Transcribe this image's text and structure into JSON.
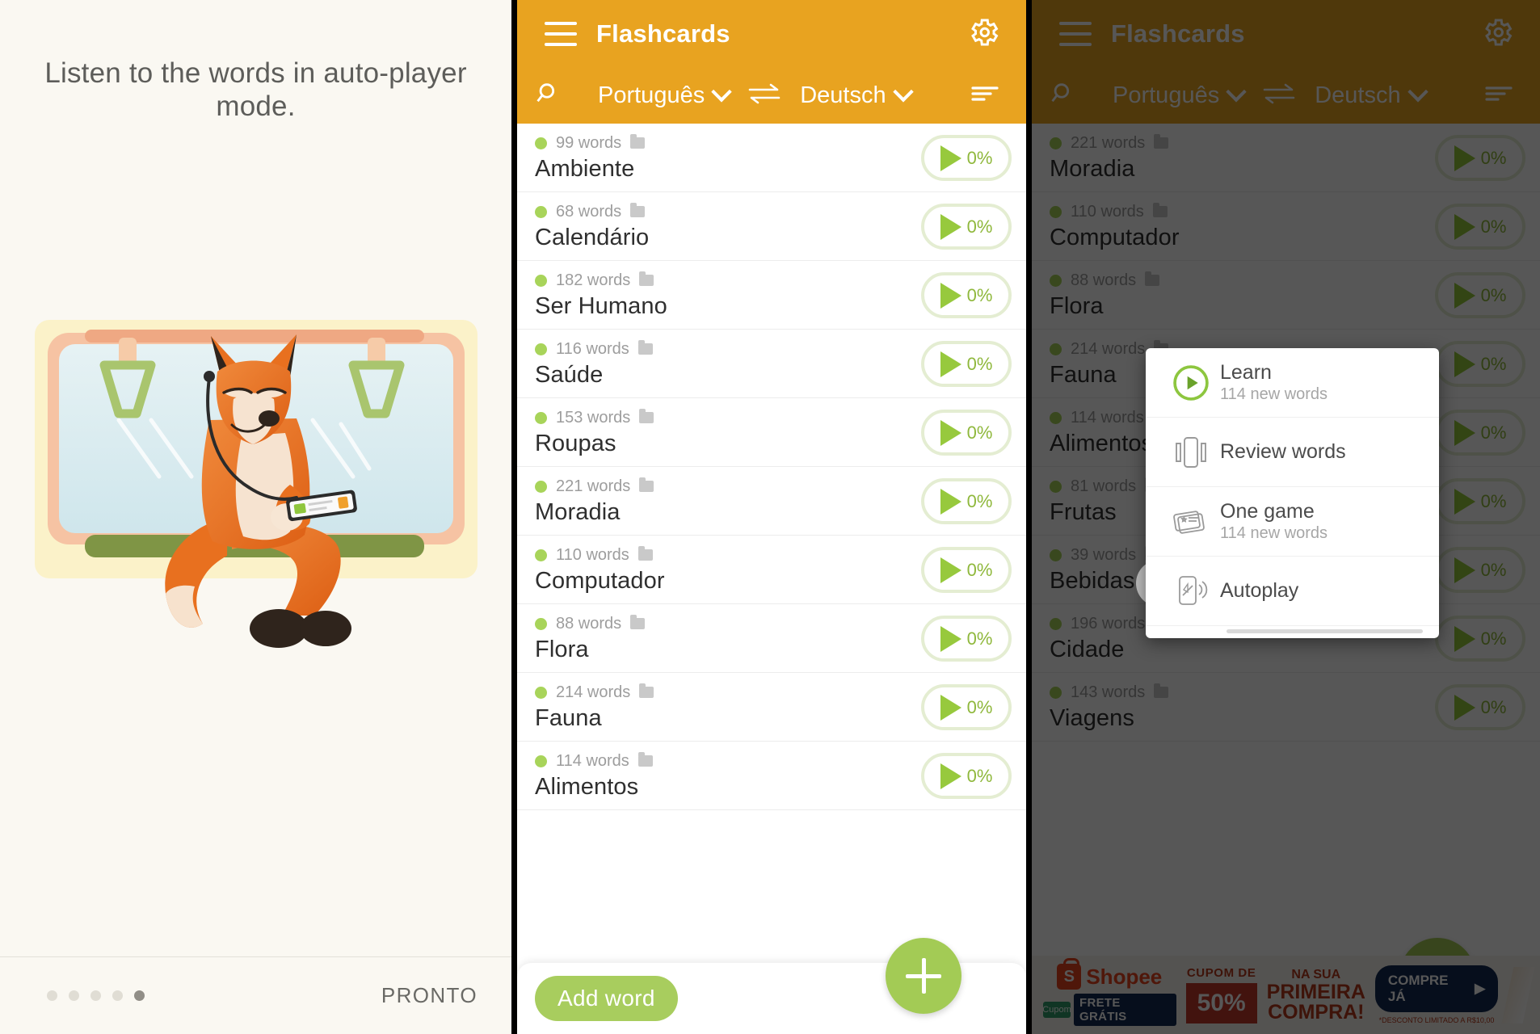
{
  "onboarding": {
    "message": "Listen to the words in auto-player mode.",
    "illustration_alt": "fox-listening-music-on-train",
    "dots_total": 5,
    "dots_active_index": 4,
    "done_label": "PRONTO"
  },
  "appbar": {
    "title": "Flashcards",
    "menu_icon": "hamburger-icon",
    "settings_icon": "gear-icon",
    "search_icon": "search-icon",
    "sort_icon": "sort-icon",
    "swap_icon": "swap-languages-icon",
    "source_language": "Português",
    "target_language": "Deutsch",
    "accent_color": "#e8a320"
  },
  "colors": {
    "accent": "#e8a320",
    "green": "#a3cb55",
    "play_green": "#97c93d",
    "pill_border": "#e4edd2",
    "text_dark": "#2f2f2f",
    "text_muted": "#9d9d9d"
  },
  "list_middle": {
    "items": [
      {
        "words": "99 words",
        "title": "Ambiente",
        "progress": "0%"
      },
      {
        "words": "68 words",
        "title": "Calendário",
        "progress": "0%"
      },
      {
        "words": "182 words",
        "title": "Ser Humano",
        "progress": "0%"
      },
      {
        "words": "116 words",
        "title": "Saúde",
        "progress": "0%"
      },
      {
        "words": "153 words",
        "title": "Roupas",
        "progress": "0%"
      },
      {
        "words": "221 words",
        "title": "Moradia",
        "progress": "0%"
      },
      {
        "words": "110 words",
        "title": "Computador",
        "progress": "0%"
      },
      {
        "words": "88 words",
        "title": "Flora",
        "progress": "0%"
      },
      {
        "words": "214 words",
        "title": "Fauna",
        "progress": "0%"
      },
      {
        "words": "114 words",
        "title": "Alimentos",
        "progress": "0%"
      }
    ]
  },
  "list_right": {
    "items": [
      {
        "words": "221 words",
        "title": "Moradia",
        "progress": "0%"
      },
      {
        "words": "110 words",
        "title": "Computador",
        "progress": "0%"
      },
      {
        "words": "88 words",
        "title": "Flora",
        "progress": "0%"
      },
      {
        "words": "214 words",
        "title": "Fauna",
        "progress": "0%"
      },
      {
        "words": "114 words",
        "title": "Alimentos",
        "progress": "0%"
      },
      {
        "words": "81 words",
        "title": "Frutas",
        "progress": "0%"
      },
      {
        "words": "39 words",
        "title": "Bebidas",
        "progress": "0%"
      },
      {
        "words": "196 words",
        "title": "Cidade",
        "progress": "0%"
      },
      {
        "words": "143 words",
        "title": "Viagens",
        "progress": "0%"
      }
    ]
  },
  "bottom": {
    "add_word_label": "Add word",
    "fab_icon": "plus-icon"
  },
  "popup": {
    "items": [
      {
        "label": "Learn",
        "sub": "114 new words",
        "icon": "play-circle-icon"
      },
      {
        "label": "Review words",
        "sub": "",
        "icon": "review-cards-icon"
      },
      {
        "label": "One game",
        "sub": "114 new words",
        "icon": "game-cards-icon"
      },
      {
        "label": "Autoplay",
        "sub": "",
        "icon": "autoplay-icon"
      }
    ]
  },
  "row_actions": [
    {
      "name": "reset-progress",
      "icon": "refresh-icon"
    },
    {
      "name": "share-export",
      "icon": "share-icon"
    },
    {
      "name": "delete",
      "icon": "trash-icon"
    }
  ],
  "ad": {
    "brand": "Shopee",
    "brand_mark": "S",
    "free_shipping_prefix": "Cupom",
    "free_shipping": "FRETE GRÁTIS",
    "coupon_head": "CUPOM DE",
    "coupon_value": "50%",
    "line1": "NA SUA",
    "line2": "PRIMEIRA",
    "line3": "COMPRA!",
    "cta": "COMPRE JÁ",
    "disclaimer": "*DESCONTO LIMITADO A R$10,00"
  }
}
